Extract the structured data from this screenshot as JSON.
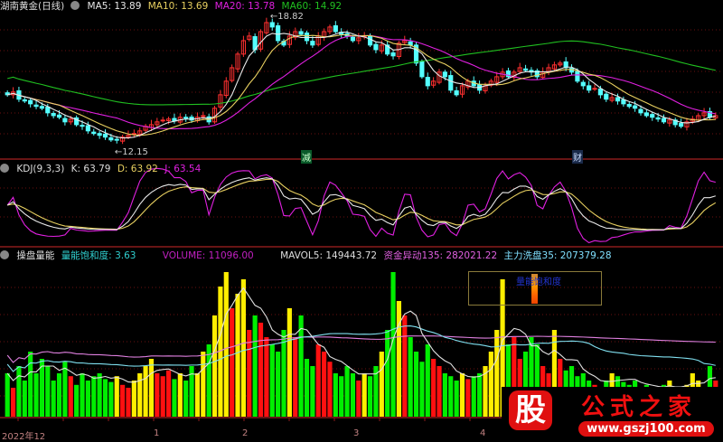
{
  "header": {
    "stock": "湖南黄金(日线)",
    "ma5": "MA5: 13.89",
    "ma10": "MA10: 13.69",
    "ma20": "MA20: 13.78",
    "ma60": "MA60: 14.92"
  },
  "kdj_header": {
    "name": "KDJ(9,3,3)",
    "k": "K: 63.79",
    "d": "D: 63.92",
    "j": "J: 63.54"
  },
  "vol_header": {
    "name": "操盘量能",
    "sat": "量能饱和度: 3.63",
    "volume": "VOLUME: 11096.00",
    "mavol5": "MAVOL5: 149443.72",
    "fund": "资金异动135: 282021.22",
    "wash": "主力洗盘35: 207379.28"
  },
  "legend_box": {
    "label": "量能饱和度"
  },
  "markers": {
    "m1": "减",
    "m2": "财"
  },
  "annotations": {
    "high": "18.82",
    "low": "12.15"
  },
  "xaxis": [
    "2022年12",
    "1",
    "2",
    "3",
    "4"
  ],
  "watermark": {
    "logo": "股",
    "name": "公式之家",
    "url": "www.gszj100.com"
  },
  "colors": {
    "up": "#ff3030",
    "down": "#54ffff",
    "ma5": "#e8e8e8",
    "ma10": "#e8d060",
    "ma20": "#e020e0",
    "ma60": "#20c020",
    "grid": "#6a1010",
    "vol_green": "#00ee00",
    "vol_red": "#ff1010",
    "vol_yellow": "#ffee00"
  },
  "chart_data": {
    "type": "candlestick",
    "title": "湖南黄金(日线)",
    "ylim": [
      12.0,
      19.2
    ],
    "closes": [
      14.86,
      15.0,
      14.64,
      14.55,
      14.41,
      14.28,
      14.19,
      13.96,
      13.82,
      13.74,
      13.51,
      13.65,
      13.37,
      13.29,
      13.06,
      12.93,
      12.84,
      12.75,
      12.61,
      12.61,
      12.75,
      12.84,
      12.93,
      13.06,
      13.29,
      13.37,
      13.51,
      13.6,
      13.65,
      13.56,
      13.74,
      13.69,
      13.6,
      13.74,
      13.82,
      13.51,
      14.19,
      14.86,
      15.54,
      16.21,
      16.89,
      17.56,
      17.79,
      17.11,
      18.01,
      18.46,
      18.24,
      17.56,
      17.34,
      17.79,
      18.01,
      17.88,
      17.56,
      17.34,
      17.79,
      18.01,
      18.24,
      18.01,
      17.88,
      17.79,
      17.56,
      17.7,
      17.79,
      17.34,
      17.11,
      17.34,
      16.89,
      16.8,
      17.43,
      17.56,
      17.34,
      16.44,
      15.76,
      15.31,
      15.54,
      15.99,
      15.76,
      15.09,
      14.86,
      15.31,
      15.54,
      15.31,
      15.09,
      15.31,
      15.54,
      15.76,
      15.99,
      15.76,
      15.99,
      16.21,
      16.08,
      15.99,
      15.76,
      15.99,
      16.21,
      16.35,
      16.44,
      16.21,
      15.99,
      15.54,
      15.31,
      15.09,
      15.18,
      14.86,
      14.64,
      14.72,
      14.55,
      14.41,
      14.28,
      14.19,
      13.96,
      13.82,
      13.74,
      13.65,
      13.51,
      13.6,
      13.37,
      13.29,
      13.51,
      13.65,
      13.82,
      13.96,
      13.74,
      13.82
    ],
    "volume": [
      30,
      20,
      35,
      25,
      45,
      30,
      40,
      35,
      25,
      30,
      38,
      28,
      22,
      30,
      25,
      28,
      30,
      26,
      24,
      28,
      22,
      20,
      25,
      30,
      35,
      40,
      30,
      28,
      32,
      26,
      30,
      25,
      35,
      30,
      45,
      50,
      70,
      90,
      100,
      75,
      85,
      95,
      60,
      70,
      65,
      55,
      50,
      45,
      60,
      75,
      55,
      70,
      40,
      35,
      50,
      45,
      38,
      30,
      28,
      35,
      30,
      25,
      30,
      28,
      35,
      45,
      60,
      100,
      80,
      70,
      55,
      45,
      38,
      50,
      40,
      35,
      30,
      28,
      25,
      30,
      26,
      28,
      30,
      35,
      45,
      60,
      95,
      50,
      55,
      40,
      45,
      55,
      50,
      35,
      30,
      60,
      40,
      32,
      35,
      28,
      30,
      25,
      22,
      20,
      25,
      30,
      28,
      24,
      22,
      25,
      20,
      22,
      20,
      18,
      22,
      25,
      18,
      20,
      22,
      30,
      25,
      20,
      35,
      25
    ],
    "kdj_params": [
      9,
      3,
      3
    ]
  }
}
